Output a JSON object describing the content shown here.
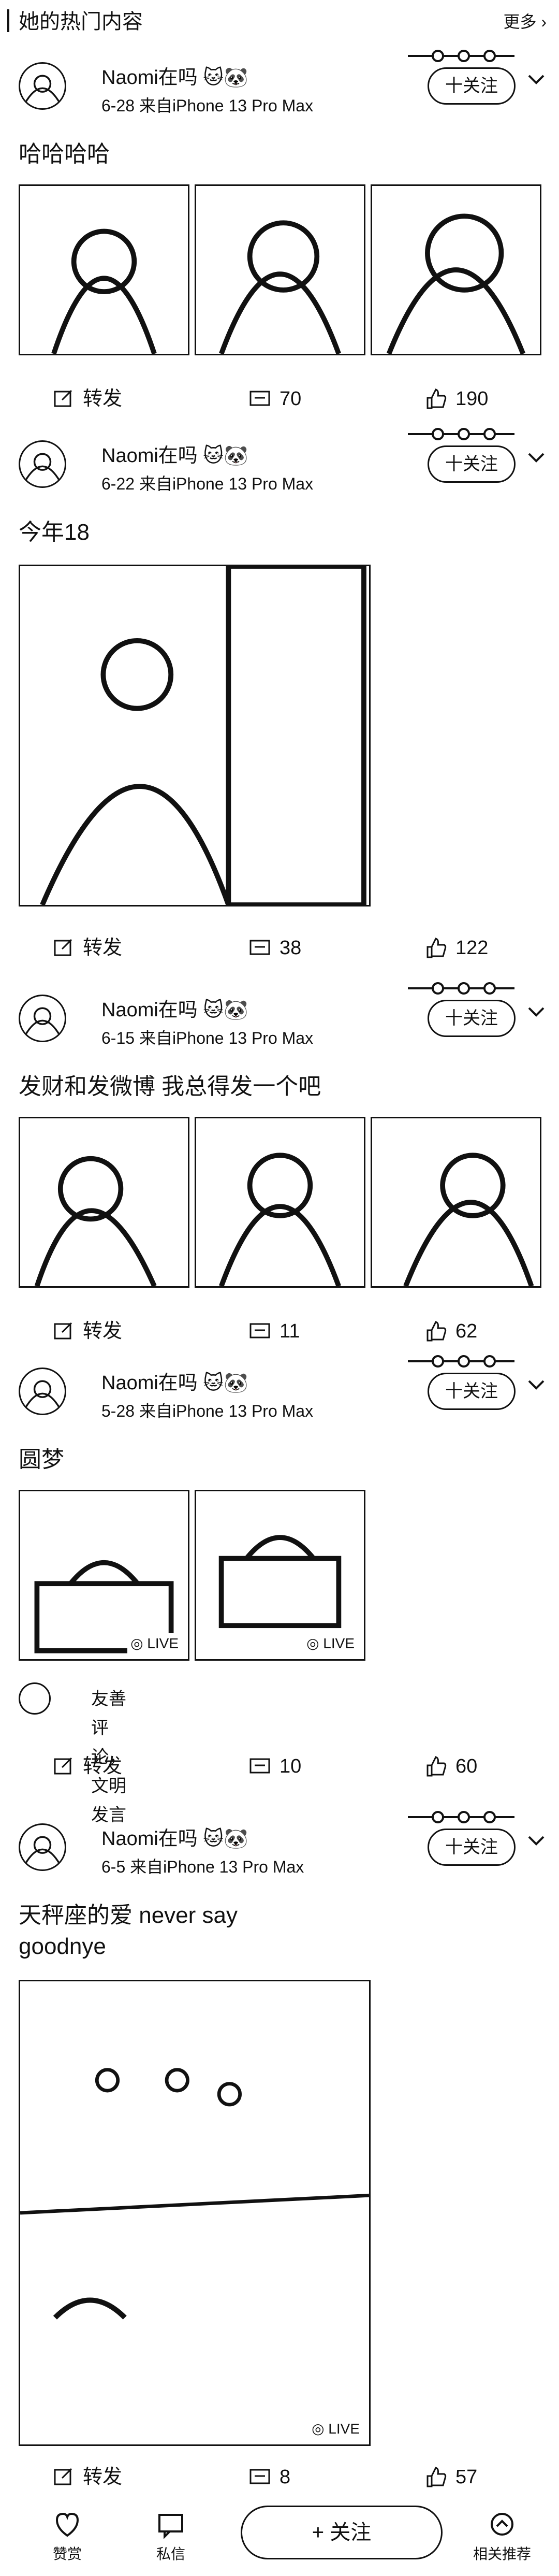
{
  "section": {
    "title": "她的热门内容",
    "more_label": "更多"
  },
  "common": {
    "username": "Naomi在吗",
    "device": "来自iPhone 13 Pro Max",
    "follow_label": "十关注",
    "actions": {
      "repost": "转发"
    },
    "live_label": "LIVE"
  },
  "posts": [
    {
      "date": "6-28",
      "text": "哈哈哈哈",
      "comments": "70",
      "likes": "190"
    },
    {
      "date": "6-22",
      "text": "今年18",
      "comments": "38",
      "likes": "122"
    },
    {
      "date": "6-15",
      "text": "发财和发微博 我总得发一个吧",
      "comments": "11",
      "likes": "62"
    },
    {
      "date": "5-28",
      "text": "圆梦",
      "comments": "10",
      "likes": "60",
      "comment_prompt": "友善评论，文明发言"
    },
    {
      "date": "6-5",
      "text_line1": "天秤座的爱 never say",
      "text_line2": "goodnye",
      "comments": "8",
      "likes": "57"
    }
  ],
  "bottom": {
    "tip_label": "赞赏",
    "message_label": "私信",
    "center_label": "关注",
    "related_label": "相关推荐"
  }
}
